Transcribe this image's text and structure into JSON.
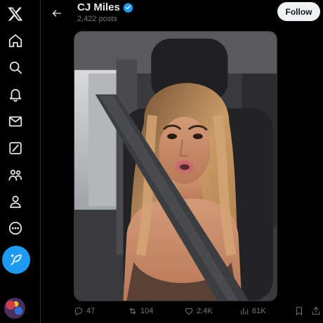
{
  "profile": {
    "name": "CJ Miles",
    "posts_count": "2,422 posts",
    "follow_label": "Follow"
  },
  "nav": {
    "items": [
      {
        "icon": "x-logo-icon"
      },
      {
        "icon": "home-icon"
      },
      {
        "icon": "search-icon"
      },
      {
        "icon": "notifications-bell-icon"
      },
      {
        "icon": "messages-envelope-icon"
      },
      {
        "icon": "grok-slash-icon"
      },
      {
        "icon": "communities-icon"
      },
      {
        "icon": "profile-person-icon"
      },
      {
        "icon": "more-dots-icon"
      },
      {
        "icon": "compose-feather-icon"
      }
    ]
  },
  "post": {
    "media_alt": "Selfie of a woman with long blonde-highlighted hair sitting in a car seat wearing a seatbelt",
    "stats": {
      "replies": "47",
      "reposts": "104",
      "likes": "2.4K",
      "views": "61K"
    }
  },
  "colors": {
    "accent": "#1d9bf0",
    "background": "#000000",
    "text": "#e7e9ea",
    "muted": "#71767b"
  }
}
